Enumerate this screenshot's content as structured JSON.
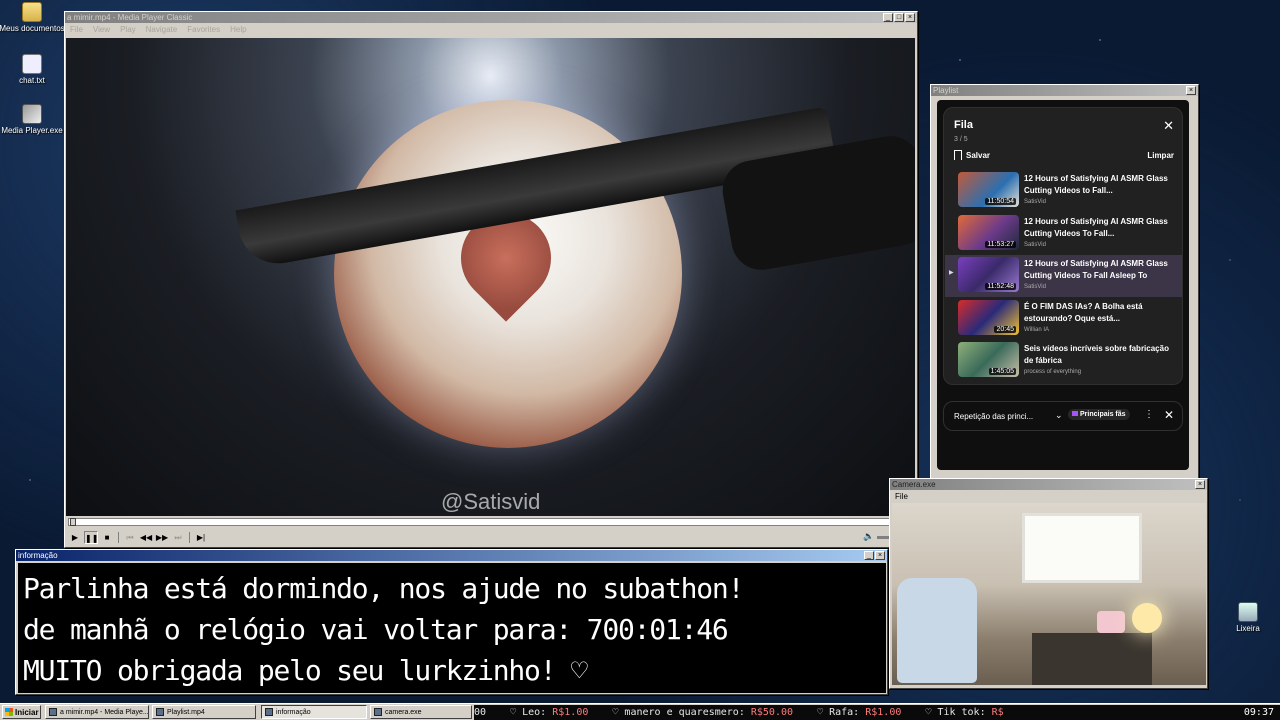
{
  "desktop": {
    "icons": [
      {
        "label": "Meus documentos",
        "icon": "folder-icon"
      },
      {
        "label": "chat.txt",
        "icon": "text-file-icon"
      },
      {
        "label": "Media Player.exe",
        "icon": "media-player-icon"
      },
      {
        "label": "Lixeira",
        "icon": "recycle-bin-icon"
      }
    ]
  },
  "mpc": {
    "title": "a mimir.mp4 - Media Player Classic",
    "menu": [
      "File",
      "View",
      "Play",
      "Navigate",
      "Favorites",
      "Help"
    ],
    "watermark": "@Satisvid"
  },
  "playlist": {
    "window_title": "Playlist",
    "heading": "Fila",
    "count": "3 / 5",
    "save_label": "Salvar",
    "clear_label": "Limpar",
    "items": [
      {
        "title": "12 Hours of Satisfying AI ASMR Glass Cutting Videos to Fall...",
        "channel": "SatisVid",
        "duration": "11:50:54",
        "current": false
      },
      {
        "title": "12 Hours of Satisfying AI ASMR Glass Cutting Videos To Fall...",
        "channel": "SatisVid",
        "duration": "11:53:27",
        "current": false
      },
      {
        "title": "12 Hours of Satisfying AI ASMR Glass Cutting Videos To Fall Asleep To",
        "channel": "SatisVid",
        "duration": "11:52:48",
        "current": true
      },
      {
        "title": "É O FIM DAS IAs? A Bolha está estourando? Oque está...",
        "channel": "Willian IA",
        "duration": "20:45",
        "current": false
      },
      {
        "title": "Seis vídeos incríveis sobre fabricação de fábrica",
        "channel": "process of everything",
        "duration": "1:45:05",
        "current": false
      }
    ],
    "repeat_label": "Repetição das princi...",
    "fans_label": "Principais fãs"
  },
  "info": {
    "title": "informação",
    "lines": [
      "Parlinha está dormindo, nos ajude no subathon!",
      "de manhã o relógio vai voltar para:  700:01:46",
      "MUITO obrigada pelo seu lurkzinho! ♡"
    ]
  },
  "camera": {
    "title": "Camera.exe",
    "menu": [
      "File"
    ]
  },
  "taskbar": {
    "start_label": "Iniciar",
    "tasks": [
      {
        "label": "a mimir.mp4 - Media Playe...",
        "pressed": false
      },
      {
        "label": "Playlist.mp4",
        "pressed": false
      },
      {
        "label": "informação",
        "pressed": true
      },
      {
        "label": "camera.exe",
        "pressed": false
      }
    ],
    "ticker": [
      {
        "text": "00",
        "money": ""
      },
      {
        "text": "♡  Leo: ",
        "money": "R$1.00"
      },
      {
        "text": "♡  manero e quaresmero: ",
        "money": "R$50.00"
      },
      {
        "text": "♡  Rafa: ",
        "money": "R$1.00"
      },
      {
        "text": "♡  Tik tok: ",
        "money": "R$"
      }
    ],
    "clock": "09:37"
  }
}
